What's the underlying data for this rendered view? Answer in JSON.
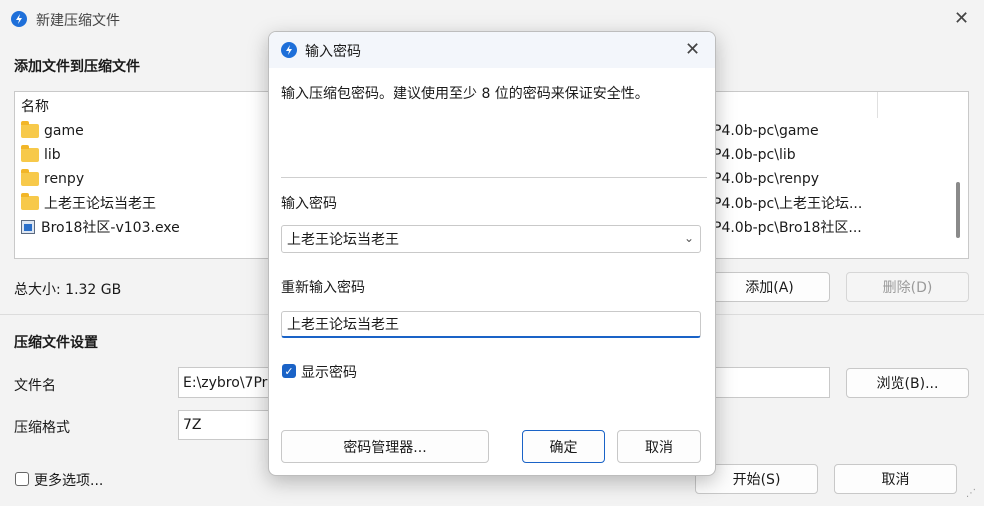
{
  "window": {
    "title": "新建压缩文件",
    "close_glyph": "✕"
  },
  "add_section": {
    "heading": "添加文件到压缩文件",
    "column_name": "名称",
    "rows": [
      {
        "name": "game",
        "icon": "folder-icon",
        "path": "P4.0b-pc\\game"
      },
      {
        "name": "lib",
        "icon": "folder-icon",
        "path": "P4.0b-pc\\lib"
      },
      {
        "name": "renpy",
        "icon": "folder-icon",
        "path": "P4.0b-pc\\renpy"
      },
      {
        "name": "上老王论坛当老王",
        "icon": "folder-icon",
        "path": "P4.0b-pc\\上老王论坛..."
      },
      {
        "name": "Bro18社区-v103.exe",
        "icon": "exe-file-icon",
        "path": "P4.0b-pc\\Bro18社区..."
      }
    ],
    "total_size": "总大小: 1.32 GB",
    "add_button": "添加(A)",
    "delete_button": "删除(D)"
  },
  "settings": {
    "heading": "压缩文件设置",
    "filename_label": "文件名",
    "filename_value": "E:\\zybro\\7Pr",
    "browse_button": "浏览(B)...",
    "format_label": "压缩格式",
    "format_value": "7Z",
    "more_options": "更多选项...",
    "start_button": "开始(S)",
    "cancel_button": "取消"
  },
  "dialog": {
    "title": "输入密码",
    "close_glyph": "✕",
    "description": "输入压缩包密码。建议使用至少 8 位的密码来保证安全性。",
    "password_label": "输入密码",
    "password_value": "上老王论坛当老王",
    "reenter_label": "重新输入密码",
    "reenter_value": "上老王论坛当老王",
    "show_password_label": "显示密码",
    "show_password_checked": true,
    "password_manager_button": "密码管理器...",
    "ok_button": "确定",
    "cancel_button": "取消"
  },
  "colors": {
    "accent": "#1a63c7",
    "app_icon": "#1e6fd9",
    "folder": "#f7c94a"
  }
}
